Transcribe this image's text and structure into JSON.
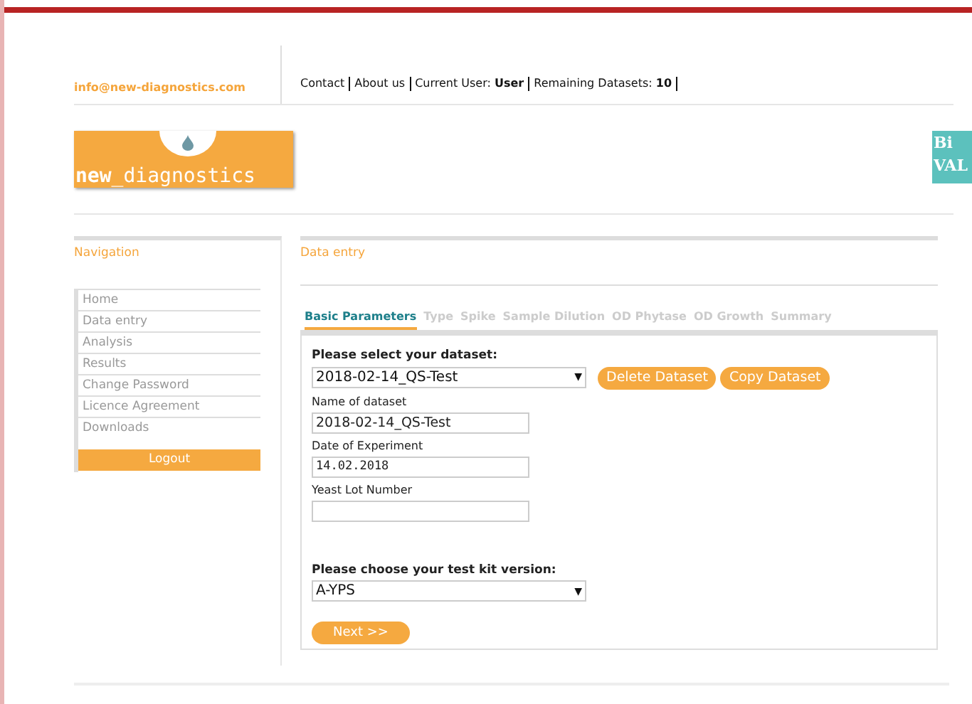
{
  "header": {
    "email": "info@new-diagnostics.com",
    "links": [
      {
        "kind": "link",
        "text": "Contact"
      },
      {
        "kind": "link",
        "text": "About us"
      },
      {
        "kind": "pair",
        "label": "Current User:",
        "value": "User"
      },
      {
        "kind": "pair",
        "label": "Remaining Datasets:",
        "value": "10"
      }
    ]
  },
  "logo": {
    "text_bold": "new",
    "text_rest": "_diagnostics"
  },
  "partner_logo": {
    "line_1": "Bi",
    "line_2": "VAL"
  },
  "navigation": {
    "title": "Navigation",
    "items": [
      "Home",
      "Data entry",
      "Analysis",
      "Results",
      "Change Password",
      "Licence Agreement",
      "Downloads"
    ],
    "logout": "Logout"
  },
  "content": {
    "title": "Data entry",
    "tabs": [
      {
        "label": "Basic Parameters",
        "selected": true
      },
      {
        "label": "Type",
        "selected": false
      },
      {
        "label": "Spike",
        "selected": false
      },
      {
        "label": "Sample Dilution",
        "selected": false
      },
      {
        "label": "OD Phytase",
        "selected": false
      },
      {
        "label": "OD Growth",
        "selected": false
      },
      {
        "label": "Summary",
        "selected": false
      }
    ],
    "dataset_select": {
      "label": "Please select your dataset:",
      "value": "2018-02-14_QS-Test",
      "arrow": "▼"
    },
    "buttons": [
      "Delete Dataset",
      "Copy Dataset"
    ],
    "fields": [
      {
        "label": "Name of dataset",
        "value": "2018-02-14_QS-Test",
        "kind": "text"
      },
      {
        "label": "Date of Experiment",
        "value": "14.02.2018",
        "kind": "date"
      },
      {
        "label": "Yeast Lot Number",
        "kind": "text"
      }
    ],
    "kit_select": {
      "label": "Please choose your test kit version:",
      "value": "A-YPS",
      "arrow": "▼"
    },
    "next": "Next >>"
  }
}
